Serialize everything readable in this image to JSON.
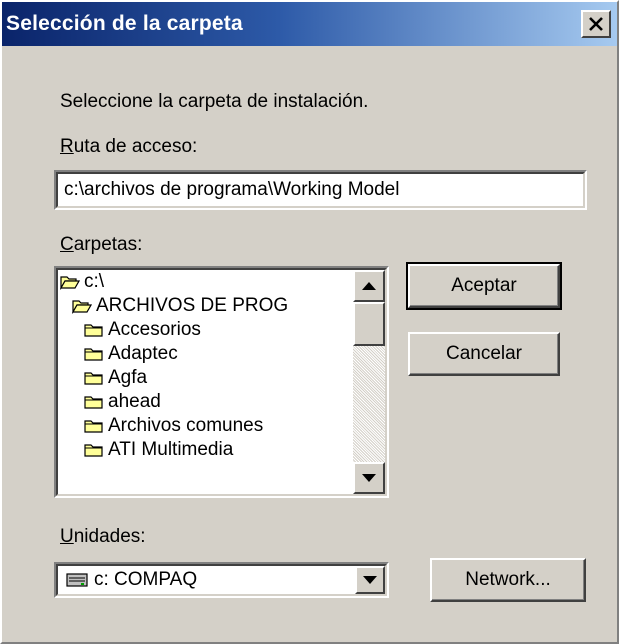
{
  "window": {
    "title": "Selección de la carpeta",
    "close_icon": "close-icon"
  },
  "instructions": "Seleccione la carpeta de instalación.",
  "path": {
    "label_underlined": "R",
    "label_rest": "uta de acceso:",
    "value": "c:\\archivos de programa\\Working Model"
  },
  "folders": {
    "label_underlined": "C",
    "label_rest": "arpetas:",
    "items": [
      {
        "label": "c:\\",
        "icon": "folder-open-icon"
      },
      {
        "label": "ARCHIVOS DE PROG",
        "icon": "folder-open-icon"
      },
      {
        "label": "Accesorios",
        "icon": "folder-icon"
      },
      {
        "label": "Adaptec",
        "icon": "folder-icon"
      },
      {
        "label": "Agfa",
        "icon": "folder-icon"
      },
      {
        "label": "ahead",
        "icon": "folder-icon"
      },
      {
        "label": "Archivos comunes",
        "icon": "folder-icon"
      },
      {
        "label": "ATI Multimedia",
        "icon": "folder-icon"
      }
    ]
  },
  "buttons": {
    "ok": "Aceptar",
    "cancel": "Cancelar",
    "network": "Network..."
  },
  "drives": {
    "label_underlined": "U",
    "label_rest": "nidades:",
    "selected": "c: COMPAQ",
    "icon": "hard-drive-icon"
  },
  "colors": {
    "title_start": "#0a246a",
    "title_end": "#a6caf0",
    "face": "#d4d0c8",
    "folder": "#ffff99"
  }
}
